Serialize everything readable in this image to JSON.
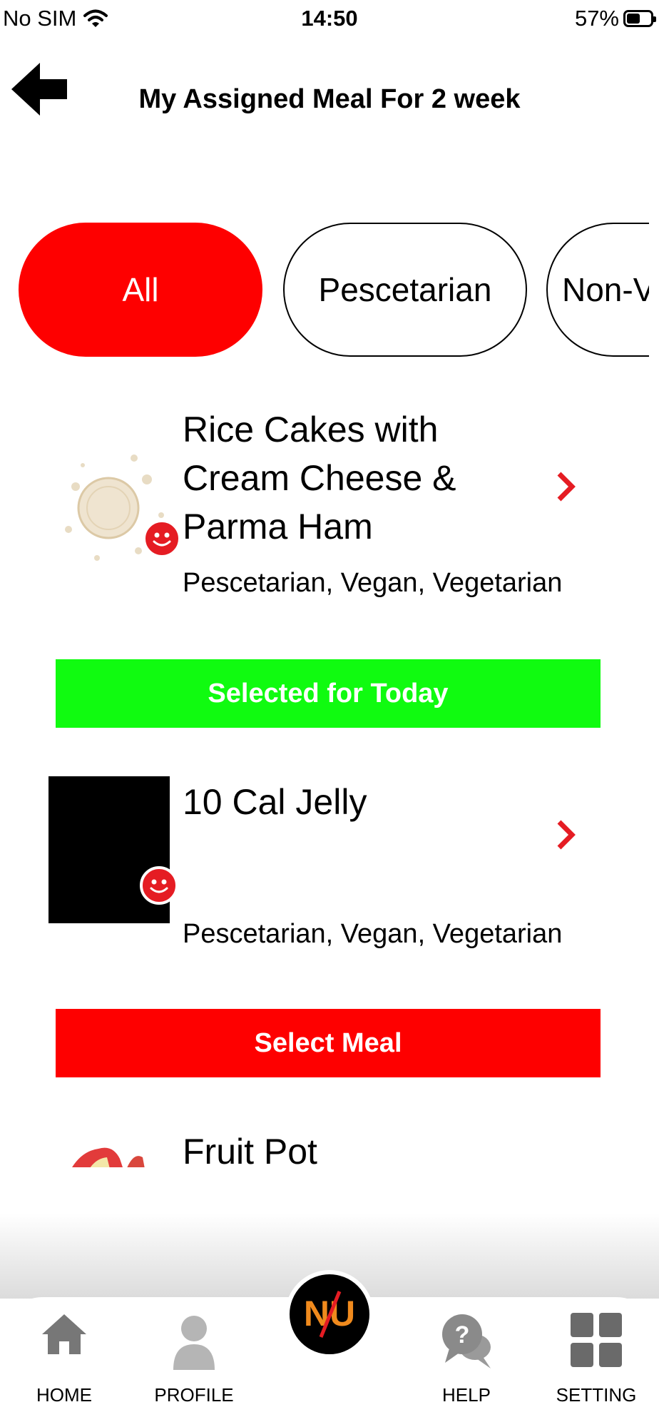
{
  "status_bar": {
    "carrier": "No SIM",
    "time": "14:50",
    "battery_percent": "57%",
    "battery_level": 0.57
  },
  "header": {
    "title": "My Assigned Meal For 2 week"
  },
  "filters": [
    {
      "label": "All",
      "active": true
    },
    {
      "label": "Pescetarian",
      "active": false
    },
    {
      "label": "Non-V",
      "active": false
    }
  ],
  "meals": [
    {
      "name": "Rice Cakes with Cream Cheese & Parma Ham",
      "tags": "Pescetarian, Vegan, Vegetarian",
      "action": "Selected for Today",
      "action_color": "#10fb10"
    },
    {
      "name": "10 Cal Jelly",
      "tags": "Pescetarian, Vegan, Vegetarian",
      "action": "Select Meal",
      "action_color": "#fe0000"
    },
    {
      "name": "Fruit Pot"
    }
  ],
  "tabs": {
    "home": "HOME",
    "profile": "PROFILE",
    "help": "HELP",
    "setting": "SETTING"
  },
  "logo": {
    "text": "NU"
  },
  "colors": {
    "accent": "#fe0000",
    "selected": "#10fb10",
    "chevron": "#e51c23",
    "tab_icon": "#777777"
  }
}
